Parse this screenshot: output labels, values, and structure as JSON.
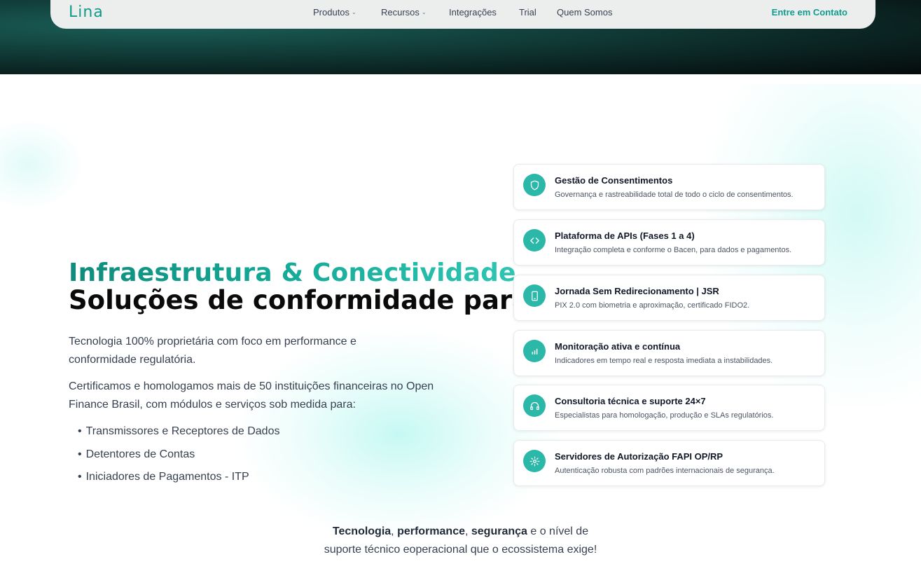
{
  "colors": {
    "brand": "#139a8a",
    "cta": "#0f9b8e",
    "icon_bg": "#2bb8a8",
    "title_gradient_start": "#0f8b7c",
    "title_gradient_end": "#2ec6b3"
  },
  "nav": {
    "logo": "Lina",
    "links": [
      {
        "label": "Produtos",
        "caret": "⌄"
      },
      {
        "label": "Recursos",
        "caret": "⌄"
      },
      {
        "label": "Integrações"
      },
      {
        "label": "Trial"
      },
      {
        "label": "Quem Somos"
      }
    ],
    "cta": "Entre em Contato"
  },
  "hero": {
    "title_line1": "Infraestrutura & Conectividade",
    "title_line2": "Soluções de conformidade para",
    "paragraph1": "Tecnologia 100% proprietária com foco em performance e conformidade regulatória.",
    "paragraph2": "Certificamos e homologamos mais de 50 instituições financeiras no Open Finance Brasil, com módulos e serviços sob medida para:",
    "bullets": [
      "Transmissores e Receptores de Dados",
      "Detentores de Contas",
      "Iniciadores de Pagamentos - ITP"
    ]
  },
  "features": [
    {
      "icon": "shield-icon",
      "title": "Gestão de Consentimentos",
      "description": "Governança e rastreabilidade total de todo o ciclo de consentimentos."
    },
    {
      "icon": "code-icon",
      "title": "Plataforma de APIs (Fases 1 a 4)",
      "description": "Integração completa e conforme o Bacen, para dados e pagamentos."
    },
    {
      "icon": "smartphone-icon",
      "title": "Jornada Sem Redirecionamento | JSR",
      "description": "PIX 2.0 com biometria e aproximação, certificado FIDO2."
    },
    {
      "icon": "bar-chart-icon",
      "title": "Monitoração ativa e contínua",
      "description": "Indicadores em tempo real e resposta imediata a instabilidades."
    },
    {
      "icon": "headphones-icon",
      "title": "Consultoria técnica e suporte 24×7",
      "description": "Especialistas para homologação, produção e SLAs regulatórios."
    },
    {
      "icon": "gear-icon",
      "title": "Servidores de Autorização FAPI OP/RP",
      "description": "Autenticação robusta com padrões internacionais de segurança."
    }
  ],
  "footer": {
    "strong1": "Tecnologia",
    "sep1": ", ",
    "strong2": "performance",
    "sep2": ", ",
    "strong3": "segurança",
    "rest_line1": " e o nível de",
    "line2": "suporte técnico eoperacional que o ecossistema exige!"
  }
}
